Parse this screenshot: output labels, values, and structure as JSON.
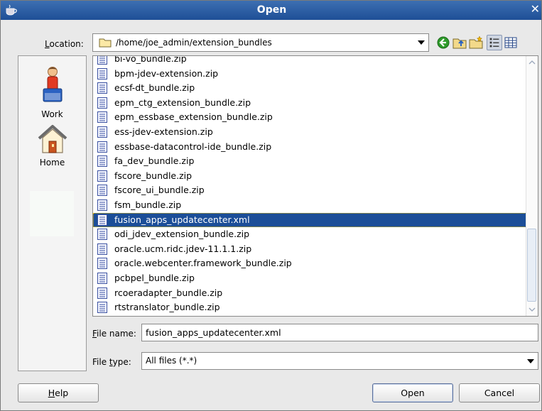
{
  "window": {
    "title": "Open",
    "close_glyph": "✕"
  },
  "location": {
    "label_mnemonic": "L",
    "label_rest": "ocation:",
    "path": "/home/joe_admin/extension_bundles"
  },
  "toolbar": [
    "back-icon",
    "up-folder-icon",
    "new-folder-icon",
    "list-view-icon",
    "details-view-icon"
  ],
  "places": [
    {
      "label": "Work",
      "icon": "work-user-icon"
    },
    {
      "label": "Home",
      "icon": "home-icon"
    }
  ],
  "files": [
    "bi-vo_bundle.zip",
    "bpm-jdev-extension.zip",
    "ecsf-dt_bundle.zip",
    "epm_ctg_extension_bundle.zip",
    "epm_essbase_extension_bundle.zip",
    "ess-jdev-extension.zip",
    "essbase-datacontrol-ide_bundle.zip",
    "fa_dev_bundle.zip",
    "fscore_bundle.zip",
    "fscore_ui_bundle.zip",
    "fsm_bundle.zip",
    "fusion_apps_updatecenter.xml",
    "odi_jdev_extension_bundle.zip",
    "oracle.ucm.ridc.jdev-11.1.1.zip",
    "oracle.webcenter.framework_bundle.zip",
    "pcbpel_bundle.zip",
    "rcoeradapter_bundle.zip",
    "rtstranslator_bundle.zip"
  ],
  "selected_index": 11,
  "file_name": {
    "label_mnemonic": "F",
    "label_rest": "ile name:",
    "value": "fusion_apps_updatecenter.xml"
  },
  "file_type": {
    "label_start": "File ",
    "label_mnemonic": "t",
    "label_rest": "ype:",
    "value": "All files (*.*)"
  },
  "buttons": {
    "help_mnemonic": "H",
    "help_rest": "elp",
    "open": "Open",
    "cancel": "Cancel"
  },
  "colors": {
    "title_bar": "#1e4f97",
    "selection": "#1b4e98",
    "dialog_bg": "#e9e9e9"
  }
}
